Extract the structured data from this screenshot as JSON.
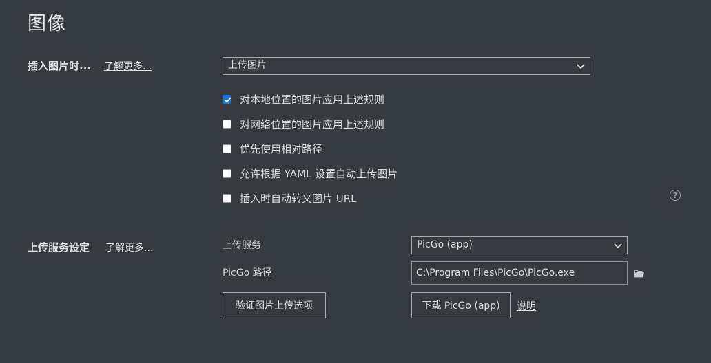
{
  "page": {
    "title": "图像"
  },
  "insert_section": {
    "label": "插入图片时...",
    "learn_more": "了解更多...",
    "select_value": "上传图片",
    "checkboxes": [
      {
        "label": "对本地位置的图片应用上述规则",
        "checked": true
      },
      {
        "label": "对网络位置的图片应用上述规则",
        "checked": false
      },
      {
        "label": "优先使用相对路径",
        "checked": false
      },
      {
        "label": "允许根据 YAML 设置自动上传图片",
        "checked": false
      },
      {
        "label": "插入时自动转义图片 URL",
        "checked": false
      }
    ],
    "help_icon": "?"
  },
  "upload_section": {
    "label": "上传服务设定",
    "learn_more": "了解更多...",
    "service_label": "上传服务",
    "service_value": "PicGo (app)",
    "path_label": "PicGo 路径",
    "path_value": "C:\\Program Files\\PicGo\\PicGo.exe",
    "verify_button": "验证图片上传选项",
    "download_button": "下载 PicGo (app)",
    "explain_link": "说明"
  },
  "icons": {
    "chevron": "chevron-down-icon",
    "folder": "folder-icon",
    "help": "help-circle-icon",
    "check": "checkmark-icon"
  },
  "colors": {
    "background": "#363b40",
    "checkbox_checked": "#1f76d2"
  }
}
